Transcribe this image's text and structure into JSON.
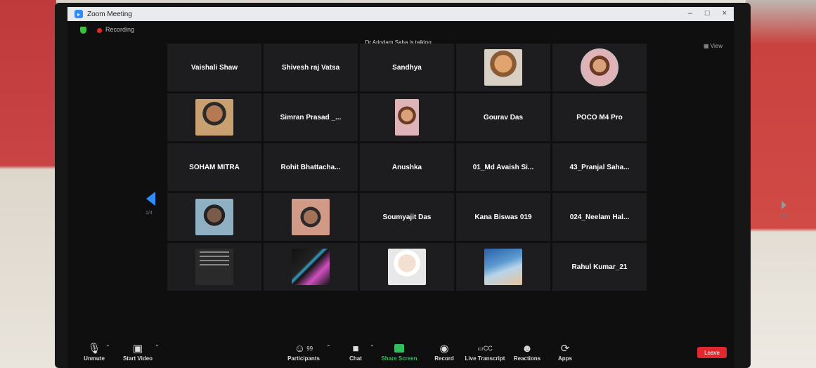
{
  "window": {
    "title": "Zoom Meeting"
  },
  "topbar": {
    "recording_label": "Recording",
    "talking": "Dr Arindam Saha is talking...",
    "view_label": "View"
  },
  "tiles": [
    {
      "name": "Vaishali Shaw"
    },
    {
      "name": "Shivesh raj Vatsa"
    },
    {
      "name": "Sandhya"
    },
    {
      "avatar": "face-icon"
    },
    {
      "avatar": "face-round-icon"
    },
    {
      "avatar": "face-icon"
    },
    {
      "name": "Simran Prasad _..."
    },
    {
      "avatar": "face-icon"
    },
    {
      "name": "Gourav Das"
    },
    {
      "name": "POCO M4 Pro"
    },
    {
      "name": "SOHAM MITRA"
    },
    {
      "name": "Rohit Bhattacha..."
    },
    {
      "name": "Anushka"
    },
    {
      "name": "01_Md Avaish Si..."
    },
    {
      "name": "43_Pranjal Saha..."
    },
    {
      "avatar": "face-icon"
    },
    {
      "avatar": "face-icon"
    },
    {
      "name": "Soumyajit Das"
    },
    {
      "name": "Kana Biswas 019"
    },
    {
      "name": "024_Neelam Hal..."
    },
    {
      "avatar": "document-icon"
    },
    {
      "avatar": "art-icon"
    },
    {
      "avatar": "anime-icon"
    },
    {
      "avatar": "landscape-icon"
    },
    {
      "name": "Rahul Kumar_21"
    }
  ],
  "toolbar": {
    "unmute": "Unmute",
    "start_video": "Start Video",
    "participants": "Participants",
    "participants_count": "99",
    "chat": "Chat",
    "share_screen": "Share Screen",
    "record": "Record",
    "live_transcript": "Live Transcript",
    "reactions": "Reactions",
    "apps": "Apps",
    "leave": "Leave"
  },
  "colors": {
    "zoom_blue": "#2d8cff",
    "share_green": "#2fbf5a",
    "leave_red": "#e0282e",
    "recording_red": "#e02b2b"
  }
}
